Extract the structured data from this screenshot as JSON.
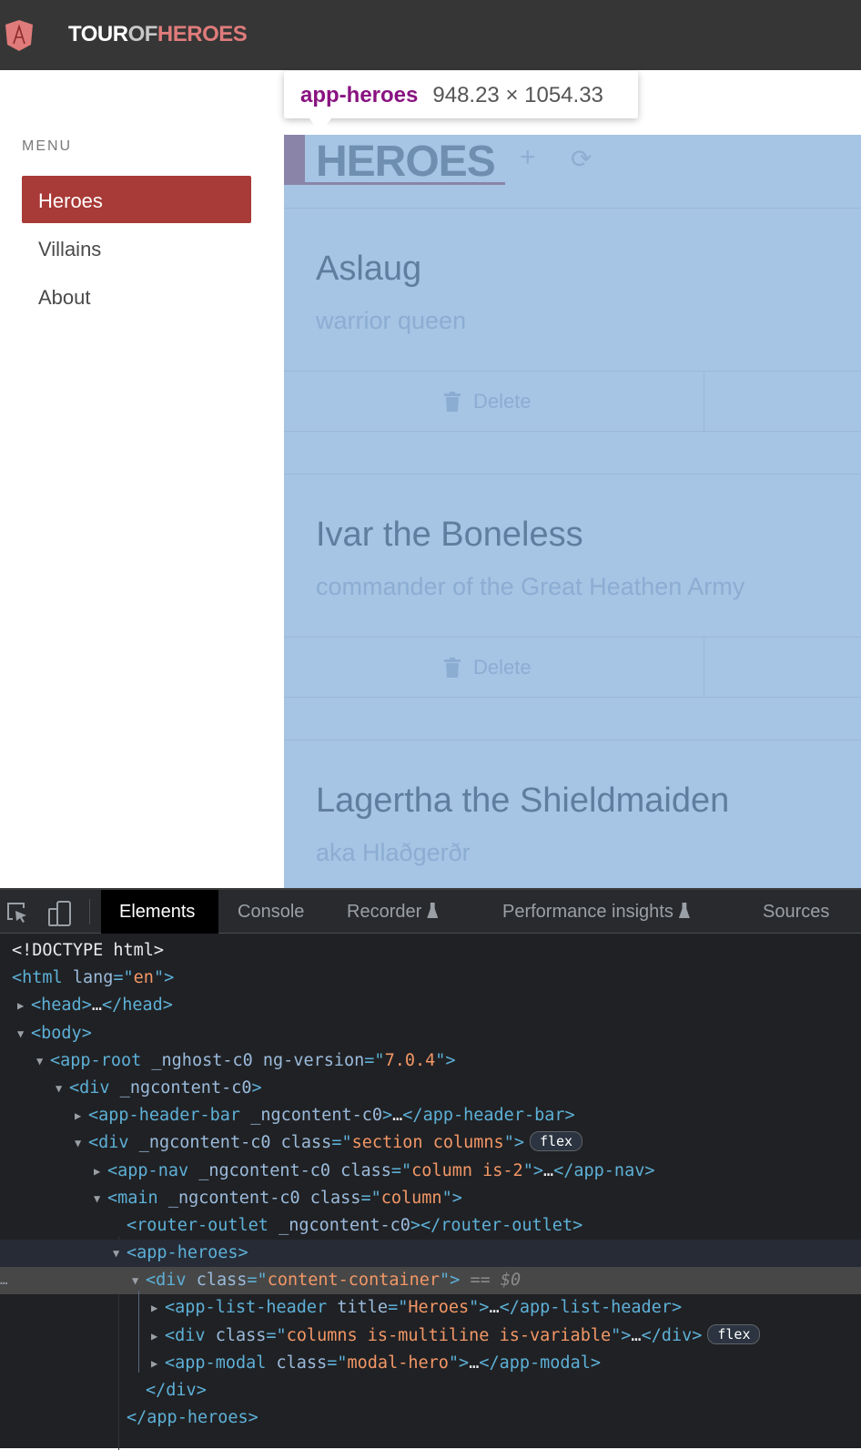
{
  "app": {
    "brand_parts": [
      "TOUR",
      "OF",
      "HEROES"
    ],
    "logo_icon": "angular-shield-icon",
    "accent": "#a83a37"
  },
  "sidebar": {
    "menu_label": "MENU",
    "items": [
      {
        "label": "Heroes",
        "active": true
      },
      {
        "label": "Villains"
      },
      {
        "label": "About"
      }
    ]
  },
  "tooltip": {
    "tag": "app-heroes",
    "dimensions": "948.23 × 1054.33"
  },
  "list_header": {
    "title": "HEROES",
    "add_icon": "plus-icon",
    "refresh_icon": "refresh-icon"
  },
  "heroes": [
    {
      "name": "Aslaug",
      "description": "warrior queen",
      "delete_label": "Delete"
    },
    {
      "name": "Ivar the Boneless",
      "description": "commander of the Great Heathen Army",
      "delete_label": "Delete"
    },
    {
      "name": "Lagertha the Shieldmaiden",
      "description": "aka Hlaðgerðr"
    }
  ],
  "devtools": {
    "tabs": [
      "Elements",
      "Console",
      "Recorder",
      "Performance insights",
      "Sources"
    ],
    "active_tab": "Elements",
    "lines": [
      {
        "level": 0,
        "tokens": [
          [
            "plain",
            "<!DOCTYPE html>"
          ]
        ]
      },
      {
        "level": 0,
        "tokens": [
          [
            "tag",
            "<html "
          ],
          [
            "an",
            "lang"
          ],
          [
            "tag",
            "=\""
          ],
          [
            "av",
            "en"
          ],
          [
            "tag",
            "\">"
          ]
        ]
      },
      {
        "level": 1,
        "arrow": "right",
        "tokens": [
          [
            "tag",
            "<head>"
          ],
          [
            "plain",
            "…"
          ],
          [
            "tag",
            "</head>"
          ]
        ]
      },
      {
        "level": 1,
        "arrow": "down",
        "tokens": [
          [
            "tag",
            "<body>"
          ]
        ]
      },
      {
        "level": 2,
        "arrow": "down",
        "tokens": [
          [
            "tag",
            "<app-root "
          ],
          [
            "an",
            "_nghost-c0 ng-version"
          ],
          [
            "tag",
            "=\""
          ],
          [
            "av",
            "7.0.4"
          ],
          [
            "tag",
            "\">"
          ]
        ]
      },
      {
        "level": 3,
        "arrow": "down",
        "tokens": [
          [
            "tag",
            "<div "
          ],
          [
            "an",
            "_ngcontent-c0"
          ],
          [
            "tag",
            ">"
          ]
        ]
      },
      {
        "level": 4,
        "arrow": "right",
        "tokens": [
          [
            "tag",
            "<app-header-bar "
          ],
          [
            "an",
            "_ngcontent-c0"
          ],
          [
            "tag",
            ">"
          ],
          [
            "plain",
            "…"
          ],
          [
            "tag",
            "</app-header-bar>"
          ]
        ]
      },
      {
        "level": 4,
        "arrow": "down",
        "tokens": [
          [
            "tag",
            "<div "
          ],
          [
            "an",
            "_ngcontent-c0 class"
          ],
          [
            "tag",
            "=\""
          ],
          [
            "av",
            "section columns"
          ],
          [
            "tag",
            "\">"
          ]
        ],
        "badge": "flex"
      },
      {
        "level": 5,
        "arrow": "right",
        "tokens": [
          [
            "tag",
            "<app-nav "
          ],
          [
            "an",
            "_ngcontent-c0 class"
          ],
          [
            "tag",
            "=\""
          ],
          [
            "av",
            "column is-2"
          ],
          [
            "tag",
            "\">"
          ],
          [
            "plain",
            "…"
          ],
          [
            "tag",
            "</app-nav>"
          ]
        ]
      },
      {
        "level": 5,
        "arrow": "down",
        "tokens": [
          [
            "tag",
            "<main "
          ],
          [
            "an",
            "_ngcontent-c0 class"
          ],
          [
            "tag",
            "=\""
          ],
          [
            "av",
            "column"
          ],
          [
            "tag",
            "\">"
          ]
        ]
      },
      {
        "level": 6,
        "tokens": [
          [
            "tag",
            "<router-outlet "
          ],
          [
            "an",
            "_ngcontent-c0"
          ],
          [
            "tag",
            "></router-outlet>"
          ]
        ]
      },
      {
        "level": 6,
        "arrow": "down",
        "state": "hover",
        "tokens": [
          [
            "tag",
            "<app-heroes>"
          ]
        ]
      },
      {
        "level": 7,
        "arrow": "down",
        "state": "selected",
        "tokens": [
          [
            "tag",
            "<div "
          ],
          [
            "an",
            "class"
          ],
          [
            "tag",
            "=\""
          ],
          [
            "av",
            "content-container"
          ],
          [
            "tag",
            "\">"
          ],
          [
            "dim",
            " == $0"
          ]
        ]
      },
      {
        "level": 8,
        "arrow": "right",
        "tokens": [
          [
            "tag",
            "<app-list-header "
          ],
          [
            "an",
            "title"
          ],
          [
            "tag",
            "=\""
          ],
          [
            "av",
            "Heroes"
          ],
          [
            "tag",
            "\">"
          ],
          [
            "plain",
            "…"
          ],
          [
            "tag",
            "</app-list-header>"
          ]
        ]
      },
      {
        "level": 8,
        "arrow": "right",
        "tokens": [
          [
            "tag",
            "<div "
          ],
          [
            "an",
            "class"
          ],
          [
            "tag",
            "=\""
          ],
          [
            "av",
            "columns is-multiline is-variable"
          ],
          [
            "tag",
            "\">"
          ],
          [
            "plain",
            "…"
          ],
          [
            "tag",
            "</div>"
          ]
        ],
        "badge": "flex"
      },
      {
        "level": 8,
        "arrow": "right",
        "tokens": [
          [
            "tag",
            "<app-modal "
          ],
          [
            "an",
            "class"
          ],
          [
            "tag",
            "=\""
          ],
          [
            "av",
            "modal-hero"
          ],
          [
            "tag",
            "\">"
          ],
          [
            "plain",
            "…"
          ],
          [
            "tag",
            "</app-modal>"
          ]
        ]
      },
      {
        "level": 7,
        "tokens": [
          [
            "tag",
            "</div>"
          ]
        ]
      },
      {
        "level": 6,
        "tokens": [
          [
            "tag",
            "</app-heroes>"
          ]
        ]
      }
    ]
  }
}
